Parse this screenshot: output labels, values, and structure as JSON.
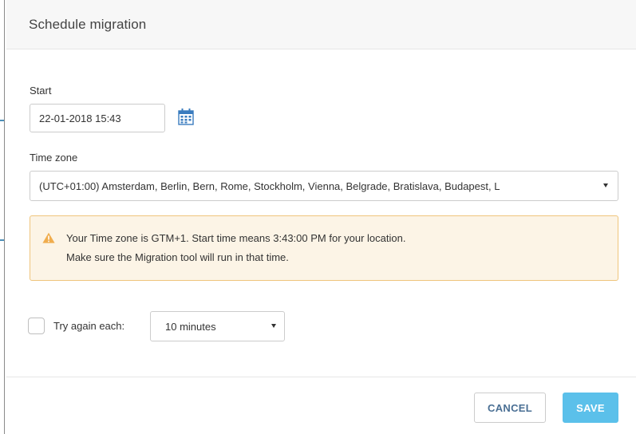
{
  "dialog": {
    "title": "Schedule migration"
  },
  "start": {
    "label": "Start",
    "value": "22-01-2018 15:43",
    "calendar_icon": "calendar-icon"
  },
  "timezone": {
    "label": "Time zone",
    "selected": "(UTC+01:00) Amsterdam, Berlin, Bern, Rome, Stockholm, Vienna, Belgrade, Bratislava, Budapest, L"
  },
  "alert": {
    "icon": "warning-icon",
    "line1": "Your Time zone is GTM+1. Start time means 3:43:00 PM for your location.",
    "line2": "Make sure the Migration tool will run in that time.",
    "background": "#fcf4e6",
    "border": "#efc57c",
    "icon_color": "#f0ad4e"
  },
  "retry": {
    "checked": false,
    "label": "Try again each:",
    "selected": "10 minutes"
  },
  "footer": {
    "cancel_label": "CANCEL",
    "save_label": "SAVE",
    "save_color": "#5bc0ea"
  }
}
